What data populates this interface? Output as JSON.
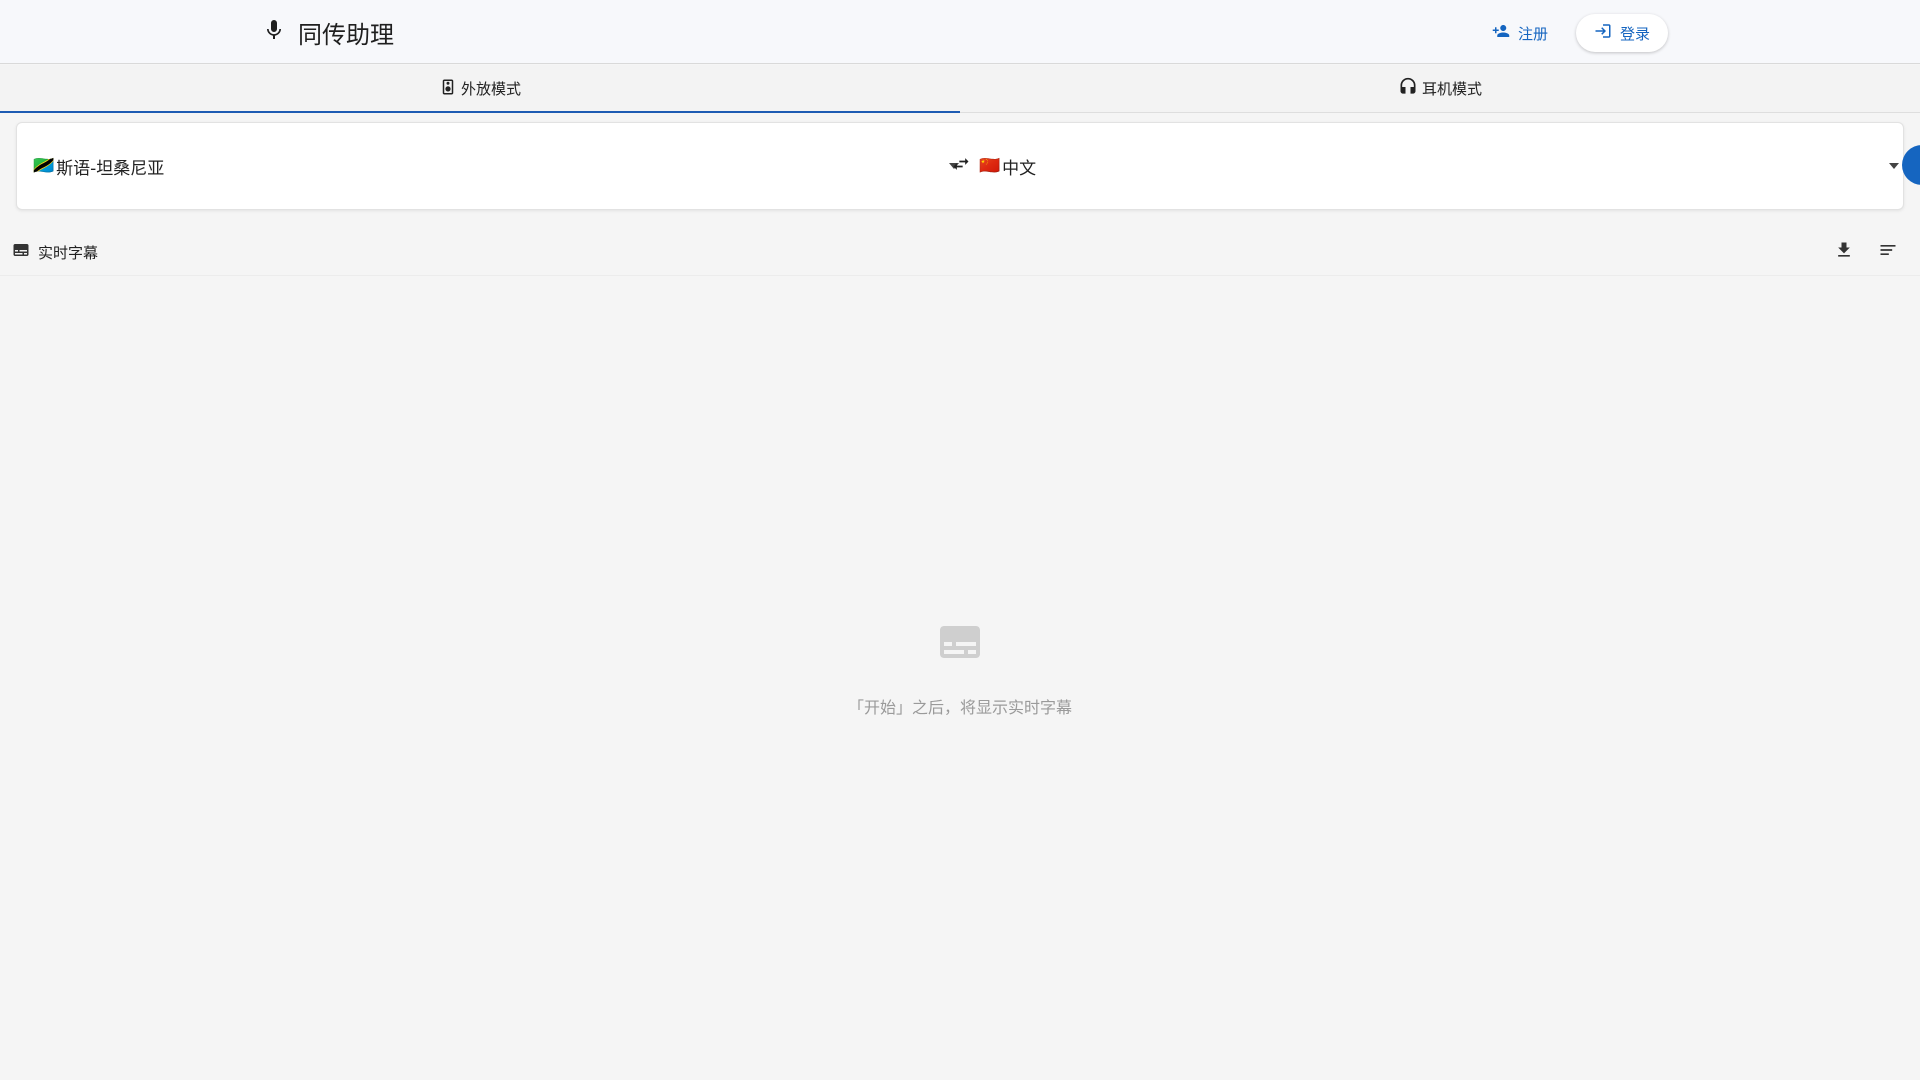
{
  "header": {
    "title": "同传助理",
    "brand_icon": "microphone-icon",
    "register_label": "注册",
    "login_label": "登录"
  },
  "tabs": [
    {
      "label": "外放模式",
      "icon": "speaker-icon",
      "active": true
    },
    {
      "label": "耳机模式",
      "icon": "headphones-icon",
      "active": false
    }
  ],
  "languages": {
    "source": {
      "flag": "🇹🇿",
      "label": "斯语-坦桑尼亚"
    },
    "target": {
      "flag": "🇨🇳",
      "label": "中文"
    }
  },
  "subtitles": {
    "label": "实时字幕",
    "empty_text": "「开始」之后，将显示实时字幕"
  },
  "colors": {
    "accent": "#1565c0",
    "tab_indicator": "#1e5cb3",
    "background": "#f5f5f5"
  }
}
